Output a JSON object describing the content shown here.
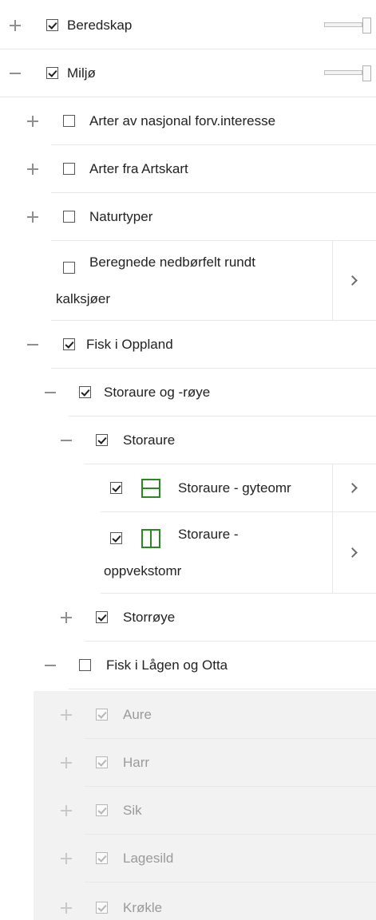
{
  "layers": [
    {
      "label": "Beredskap",
      "toggle": "plus",
      "checked": true,
      "slider": true
    },
    {
      "label": "Miljø",
      "toggle": "minus",
      "checked": true,
      "slider": true
    },
    {
      "label": "Arter av nasjonal forv.interesse",
      "toggle": "plus",
      "checked": false
    },
    {
      "label": "Arter fra Artskart",
      "toggle": "plus",
      "checked": false
    },
    {
      "label": "Naturtyper",
      "toggle": "plus",
      "checked": false
    },
    {
      "label": "Beregnede nedbørfelt rundt kalksjøer",
      "toggle": "none",
      "checked": false,
      "chevron": true
    },
    {
      "label": "Fisk i Oppland",
      "toggle": "minus",
      "checked": true
    },
    {
      "label": "Storaure og -røye",
      "toggle": "minus",
      "checked": true
    },
    {
      "label": "Storaure",
      "toggle": "minus",
      "checked": true
    },
    {
      "label": "Storaure - gyteomr",
      "toggle": "none",
      "checked": true,
      "legend": "polygon-hline",
      "chevron": true
    },
    {
      "label": "Storaure - oppvekstomr",
      "toggle": "none",
      "checked": true,
      "legend": "polygon-vline",
      "chevron": true
    },
    {
      "label": "Storrøye",
      "toggle": "plus",
      "checked": true
    },
    {
      "label": "Fisk i Lågen og Otta",
      "toggle": "minus",
      "checked": false
    },
    {
      "label": "Aure",
      "toggle": "plus",
      "checked": true,
      "disabled": true
    },
    {
      "label": "Harr",
      "toggle": "plus",
      "checked": true,
      "disabled": true
    },
    {
      "label": "Sik",
      "toggle": "plus",
      "checked": true,
      "disabled": true
    },
    {
      "label": "Lagesild",
      "toggle": "plus",
      "checked": true,
      "disabled": true
    },
    {
      "label": "Krøkle",
      "toggle": "plus",
      "checked": true,
      "disabled": true
    }
  ],
  "colors": {
    "legend_green": "#2b8a1f",
    "disabled_bg": "#f2f2f2",
    "separator": "#e8e8e8"
  }
}
